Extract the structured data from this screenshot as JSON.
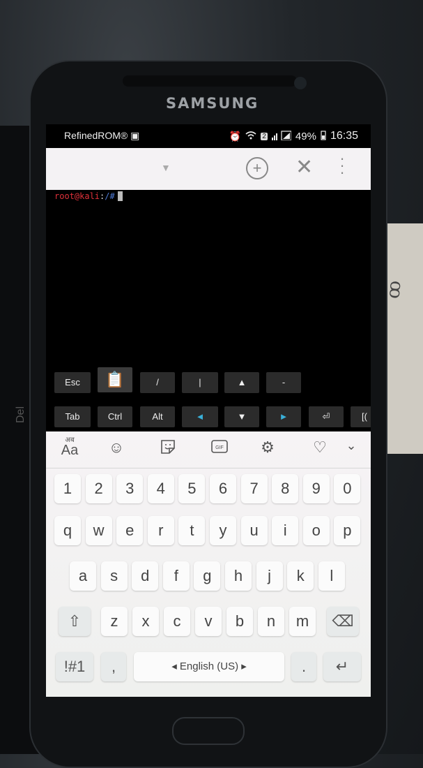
{
  "background": {
    "desk_brand": "Del",
    "paper_note": "ꝏ"
  },
  "phone": {
    "brand": "SAMSUNG"
  },
  "status_bar": {
    "app_name": "RefinedROM®",
    "sim_slot": "2",
    "battery": "49%",
    "time": "16:35"
  },
  "toolbar": {
    "dropdown_icon": "chevron-down-icon",
    "add_icon": "plus-circle-icon",
    "close_icon": "close-icon",
    "more_icon": "more-vert-icon"
  },
  "terminal": {
    "user_host": "root@kali",
    "separator": ":",
    "path": "/#"
  },
  "extra_keys": {
    "row1": [
      "Esc",
      "📋",
      "/",
      "|",
      "▲",
      "-"
    ],
    "row2": [
      "Tab",
      "Ctrl",
      "Alt",
      "◄",
      "▼",
      "►",
      "⏎",
      "[("
    ]
  },
  "keyboard": {
    "tools": {
      "lang_small": "अब",
      "lang_big": "Aa"
    },
    "numbers": [
      "1",
      "2",
      "3",
      "4",
      "5",
      "6",
      "7",
      "8",
      "9",
      "0"
    ],
    "row_q": [
      "q",
      "w",
      "e",
      "r",
      "t",
      "y",
      "u",
      "i",
      "o",
      "p"
    ],
    "row_a": [
      "a",
      "s",
      "d",
      "f",
      "g",
      "h",
      "j",
      "k",
      "l"
    ],
    "row_z": [
      "z",
      "x",
      "c",
      "v",
      "b",
      "n",
      "m"
    ],
    "shift": "⇧",
    "backspace": "⌫",
    "symbols": "!#1",
    "comma": ",",
    "space": "◂  English (US)  ▸",
    "period": ".",
    "enter": "↵"
  }
}
